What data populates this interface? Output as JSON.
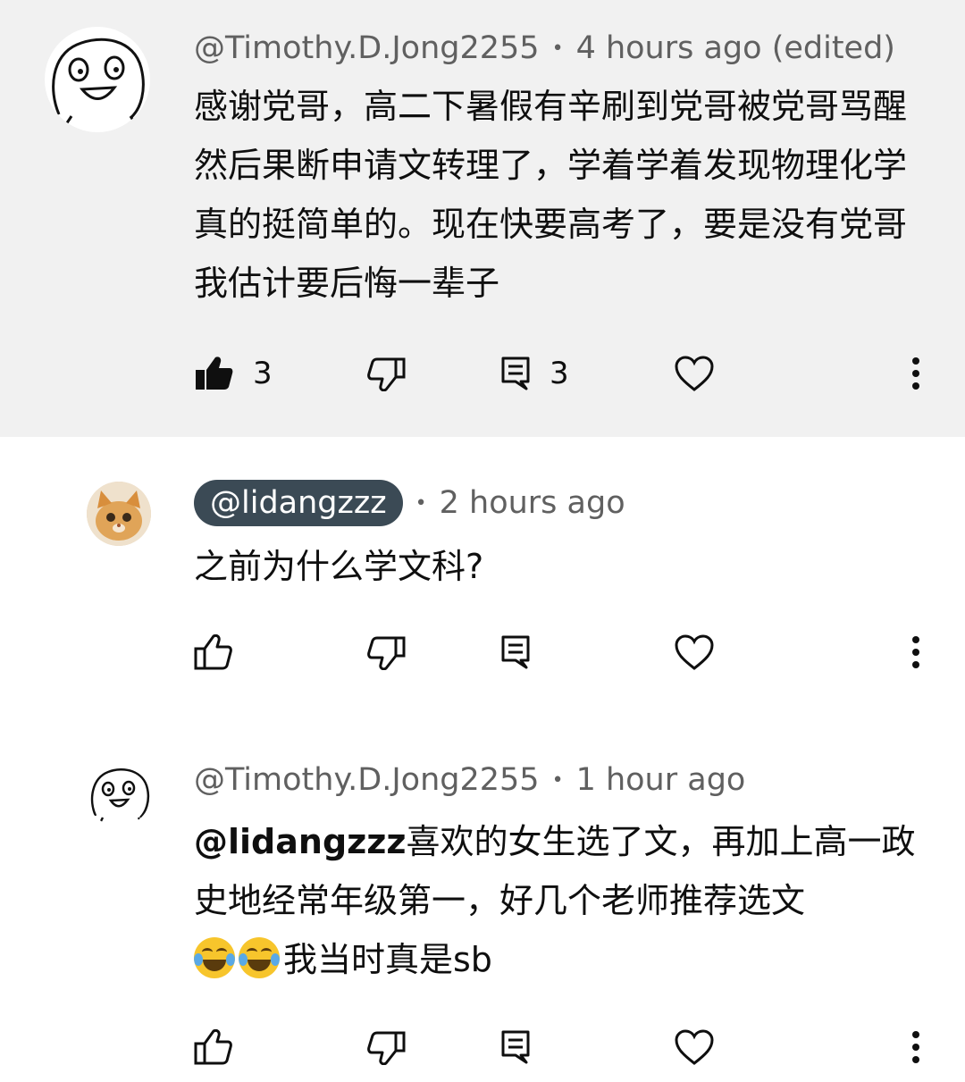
{
  "comments": [
    {
      "author": "@Timothy.D.Jong2255",
      "time": "4 hours ago (edited)",
      "text": "感谢党哥，高二下暑假有辛刷到党哥被党哥骂醒然后果断申请文转理了，学着学着发现物理化学真的挺简单的。现在快要高考了，要是没有党哥我估计要后悔一辈子",
      "likes": "3",
      "replies": "3",
      "liked": true,
      "highlighted": true
    },
    {
      "author": "@lidangzzz",
      "time": "2 hours ago",
      "text": "之前为什么学文科?",
      "author_is_creator_chip": true
    },
    {
      "author": "@Timothy.D.Jong2255",
      "time": "1 hour ago",
      "mention": "@lidangzzz",
      "text": "喜欢的女生选了文，再加上高一政史地经常年级第一，好几个老师推荐选文",
      "text_after_emoji": "我当时真是sb",
      "emojis": [
        "face-with-tears-of-joy",
        "face-with-tears-of-joy"
      ]
    }
  ],
  "icons": {
    "like": "thumbs-up-icon",
    "dislike": "thumbs-down-icon",
    "reply": "reply-icon",
    "heart": "heart-icon",
    "more": "more-vertical-icon"
  },
  "colors": {
    "highlight_bg": "#f1f1f1",
    "meta_text": "#606060",
    "chip_bg": "#3b4a55"
  }
}
